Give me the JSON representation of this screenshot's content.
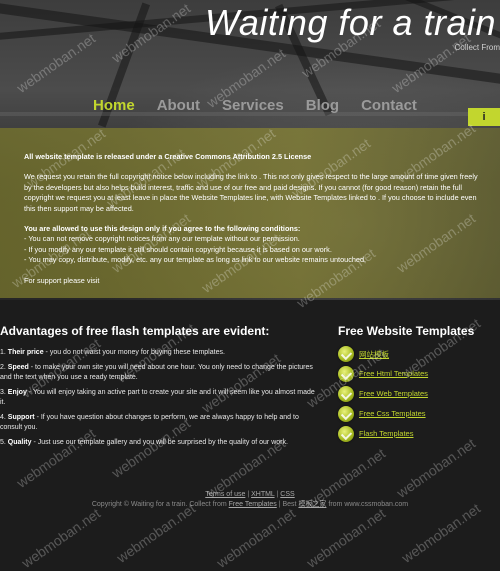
{
  "header": {
    "title": "Waiting for a train",
    "collect_text": "Collect From"
  },
  "nav": {
    "items": [
      {
        "label": "Home",
        "active": true
      },
      {
        "label": "About",
        "active": false
      },
      {
        "label": "Services",
        "active": false
      },
      {
        "label": "Blog",
        "active": false
      },
      {
        "label": "Contact",
        "active": false
      }
    ],
    "side_tab": "i"
  },
  "notice": {
    "heading": "All website template is released under a Creative Commons Attribution 2.5 License",
    "para1": "We request you retain the full copyright notice below including the link to . This not only gives respect to the large amount of time given freely by the developers but also helps build interest, traffic and use of our free and paid designs. If you cannot (for good reason) retain the full copyright we request you at least leave in place the Website Templates line, with Website Templates linked to . If you choose to include even this then support may be affected.",
    "allowed_heading": "You are allowed to use this design only if you agree to the following conditions:",
    "conditions": [
      "- You can not remove copyright notices from any our template without our permission.",
      "- If you modify any our template it still should contain copyright because it is based on our work.",
      "- You may copy, distribute, modify, etc. any our template as long as link to our website remains untouched."
    ],
    "support": "For support please visit"
  },
  "advantages": {
    "heading": "Advantages of free flash templates are evident:",
    "items": [
      {
        "num": "1.",
        "label": "Their price",
        "text": " - you do not waist your money for buying these templates."
      },
      {
        "num": "2.",
        "label": "Speed",
        "text": " - to make your own site you will need about one hour. You only need to change the pictures and the text when you use a ready template."
      },
      {
        "num": "3.",
        "label": "Enjoy",
        "text": " - You will enjoy taking an active part to create your site and it will seem like you almost made it."
      },
      {
        "num": "4.",
        "label": "Support",
        "text": " - If you have question about changes to perform, we are always happy to help and to consult you."
      },
      {
        "num": "5.",
        "label": "Quality",
        "text": " - Just use our template gallery and you will be surprised by the quality of our work."
      }
    ]
  },
  "templates": {
    "heading": "Free Website Templates",
    "links": [
      "网站模板",
      "Free Html Templates",
      "Free Web Templates",
      "Free Css Templates",
      "Flash Templates"
    ]
  },
  "footer": {
    "terms": "Terms of use",
    "sep1": " | ",
    "xhtml": "XHTML",
    "sep2": " | ",
    "css": "CSS",
    "copyright_pre": "Copyright © Waiting for a train. Collect from ",
    "free_templates": "Free Templates",
    "copyright_mid": " | Best ",
    "cn_link": "模板之家",
    "copyright_post": " from www.cssmoban.com"
  },
  "watermark": "webmoban.net"
}
